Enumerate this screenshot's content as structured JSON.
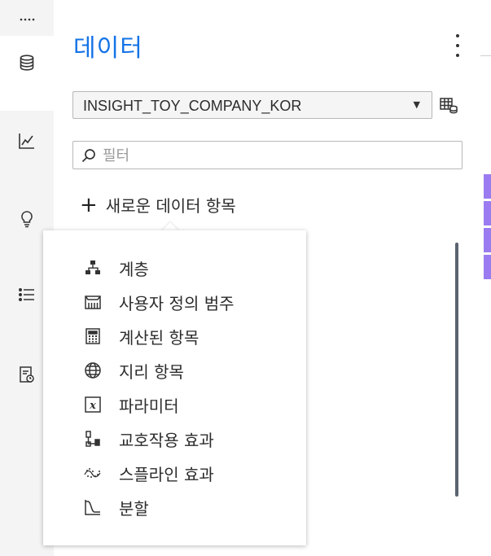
{
  "rail": {
    "items": [
      {
        "name": "data",
        "icon": "database-icon"
      },
      {
        "name": "visualize",
        "icon": "line-chart-icon"
      },
      {
        "name": "insights",
        "icon": "lightbulb-icon"
      },
      {
        "name": "list",
        "icon": "list-icon"
      },
      {
        "name": "report",
        "icon": "report-icon"
      }
    ]
  },
  "panel": {
    "title": "데이터",
    "dataset": "INSIGHT_TOY_COMPANY_KOR",
    "filter_placeholder": "필터",
    "new_item_label": "새로운 데이터 항목"
  },
  "menu": {
    "items": [
      {
        "label": "계층",
        "icon": "hierarchy-icon"
      },
      {
        "label": "사용자 정의 범주",
        "icon": "custom-category-icon"
      },
      {
        "label": "계산된 항목",
        "icon": "calculator-icon"
      },
      {
        "label": "지리 항목",
        "icon": "globe-icon"
      },
      {
        "label": "파라미터",
        "icon": "parameter-icon"
      },
      {
        "label": "교호작용 효과",
        "icon": "interaction-effect-icon"
      },
      {
        "label": "스플라인 효과",
        "icon": "spline-effect-icon"
      },
      {
        "label": "분할",
        "icon": "partition-icon"
      }
    ]
  },
  "colors": {
    "accent": "#1473e6",
    "purple": "#9b7cf0"
  }
}
